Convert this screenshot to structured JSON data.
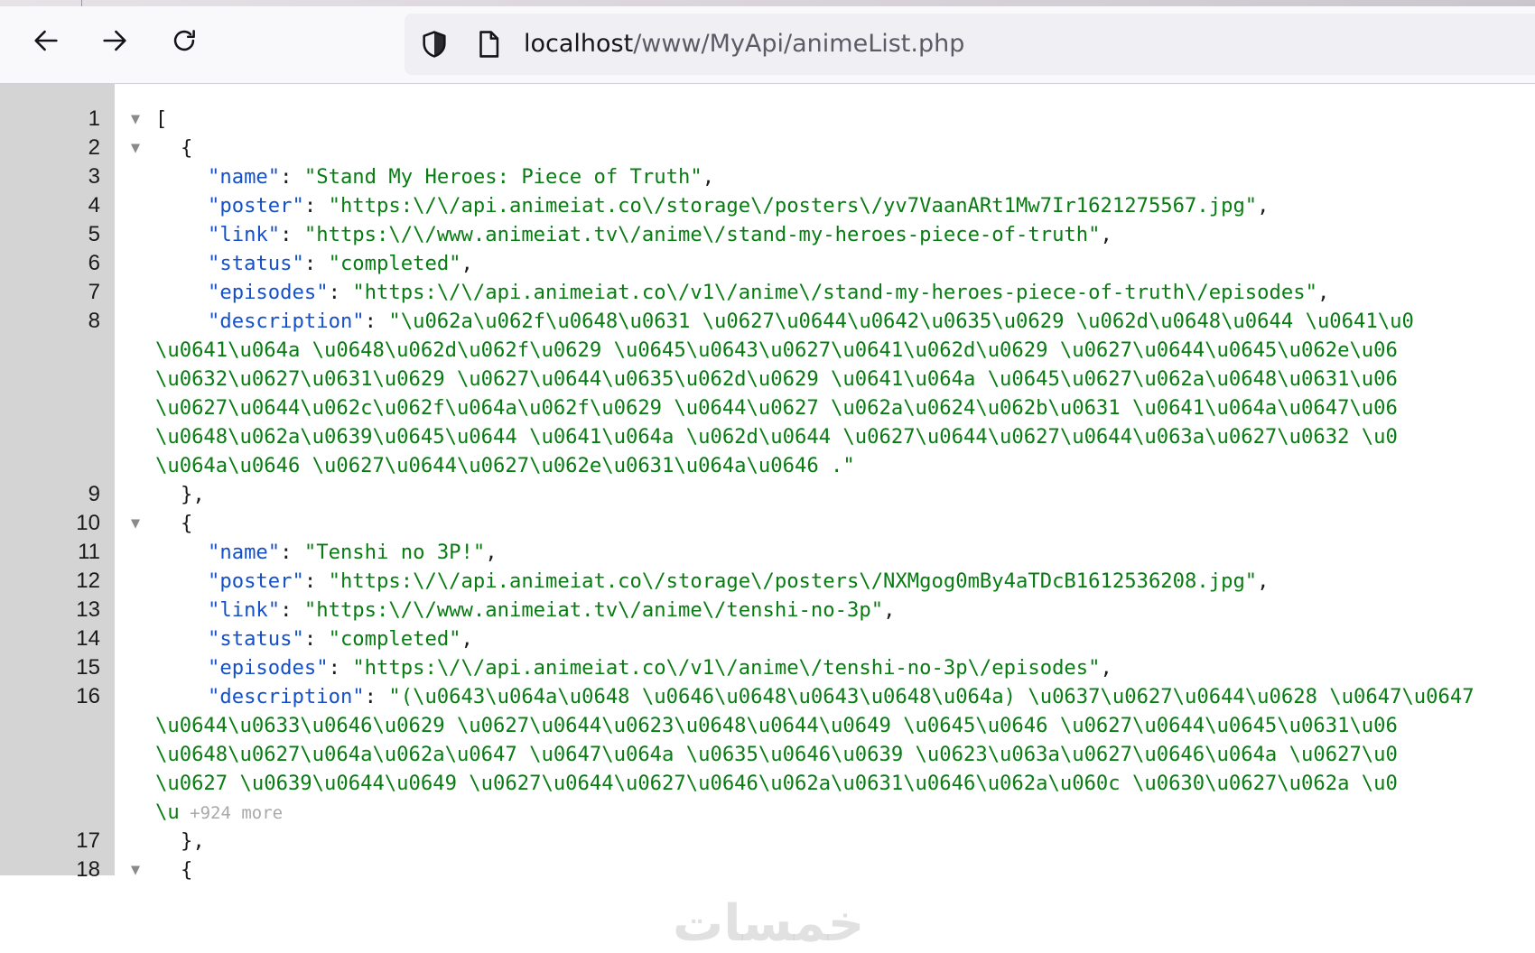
{
  "browser": {
    "nav": {
      "back_icon": "arrow-left-icon",
      "forward_icon": "arrow-right-icon",
      "reload_icon": "reload-icon"
    },
    "urlbar": {
      "security_icon": "shield-icon",
      "page_icon": "page-icon",
      "host": "localhost",
      "path": "/www/MyApi/animeList.php"
    }
  },
  "json_viewer": {
    "lines": [
      {
        "n": "1",
        "twisty": "▼",
        "open": "["
      },
      {
        "n": "2",
        "twisty": "▼",
        "open": "{"
      },
      {
        "n": "3",
        "key": "\"name\"",
        "value": "\"Stand My Heroes: Piece of Truth\"",
        "tail": ","
      },
      {
        "n": "4",
        "key": "\"poster\"",
        "value": "\"https:\\/\\/api.animeiat.co\\/storage\\/posters\\/yv7VaanARt1Mw7Ir1621275567.jpg\"",
        "tail": ","
      },
      {
        "n": "5",
        "key": "\"link\"",
        "value": "\"https:\\/\\/www.animeiat.tv\\/anime\\/stand-my-heroes-piece-of-truth\"",
        "tail": ","
      },
      {
        "n": "6",
        "key": "\"status\"",
        "value": "\"completed\"",
        "tail": ","
      },
      {
        "n": "7",
        "key": "\"episodes\"",
        "value": "\"https:\\/\\/api.animeiat.co\\/v1\\/anime\\/stand-my-heroes-piece-of-truth\\/episodes\"",
        "tail": ","
      },
      {
        "n": "8",
        "key": "\"description\"",
        "value": "\"\\u062a\\u062f\\u0648\\u0631 \\u0627\\u0644\\u0642\\u0635\\u0629 \\u062d\\u0648\\u0644 \\u0641\\u0",
        "tail": ""
      },
      {
        "wrap": "\\u0641\\u064a \\u0648\\u062d\\u062f\\u0629 \\u0645\\u0643\\u0627\\u0641\\u062d\\u0629 \\u0627\\u0644\\u0645\\u062e\\u06"
      },
      {
        "wrap": "\\u0632\\u0627\\u0631\\u0629 \\u0627\\u0644\\u0635\\u062d\\u0629 \\u0641\\u064a \\u0645\\u0627\\u062a\\u0648\\u0631\\u06"
      },
      {
        "wrap": "\\u0627\\u0644\\u062c\\u062f\\u064a\\u062f\\u0629 \\u0644\\u0627 \\u062a\\u0624\\u062b\\u0631 \\u0641\\u064a\\u0647\\u06"
      },
      {
        "wrap": "\\u0648\\u062a\\u0639\\u0645\\u0644 \\u0641\\u064a \\u062d\\u0644 \\u0627\\u0644\\u0627\\u0644\\u063a\\u0627\\u0632 \\u0"
      },
      {
        "wrap": "\\u064a\\u0646 \\u0627\\u0644\\u0627\\u062e\\u0631\\u064a\\u0646 .\""
      },
      {
        "n": "9",
        "close": "},"
      },
      {
        "n": "10",
        "twisty": "▼",
        "open": "{"
      },
      {
        "n": "11",
        "key": "\"name\"",
        "value": "\"Tenshi no 3P!\"",
        "tail": ","
      },
      {
        "n": "12",
        "key": "\"poster\"",
        "value": "\"https:\\/\\/api.animeiat.co\\/storage\\/posters\\/NXMgog0mBy4aTDcB1612536208.jpg\"",
        "tail": ","
      },
      {
        "n": "13",
        "key": "\"link\"",
        "value": "\"https:\\/\\/www.animeiat.tv\\/anime\\/tenshi-no-3p\"",
        "tail": ","
      },
      {
        "n": "14",
        "key": "\"status\"",
        "value": "\"completed\"",
        "tail": ","
      },
      {
        "n": "15",
        "key": "\"episodes\"",
        "value": "\"https:\\/\\/api.animeiat.co\\/v1\\/anime\\/tenshi-no-3p\\/episodes\"",
        "tail": ","
      },
      {
        "n": "16",
        "key": "\"description\"",
        "value": "\"(\\u0643\\u064a\\u0648 \\u0646\\u0648\\u0643\\u0648\\u064a) \\u0637\\u0627\\u0644\\u0628 \\u0647\\u0647",
        "tail": ""
      },
      {
        "wrap": "\\u0644\\u0633\\u0646\\u0629 \\u0627\\u0644\\u0623\\u0648\\u0644\\u0649 \\u0645\\u0646 \\u0627\\u0644\\u0645\\u0631\\u06"
      },
      {
        "wrap": "\\u0648\\u0627\\u064a\\u062a\\u0647 \\u0647\\u064a \\u0635\\u0646\\u0639 \\u0623\\u063a\\u0627\\u0646\\u064a \\u0627\\u0"
      },
      {
        "wrap": "\\u0627 \\u0639\\u0644\\u0649 \\u0627\\u0644\\u0627\\u0646\\u062a\\u0631\\u0646\\u062a\\u060c \\u0630\\u0627\\u062a \\u0"
      },
      {
        "wrap": "\\u",
        "more": "+924 more"
      },
      {
        "n": "17",
        "close": "},"
      },
      {
        "n": "18",
        "twisty": "▼",
        "open": "{"
      }
    ]
  },
  "watermark": {
    "text": "خمسات"
  }
}
